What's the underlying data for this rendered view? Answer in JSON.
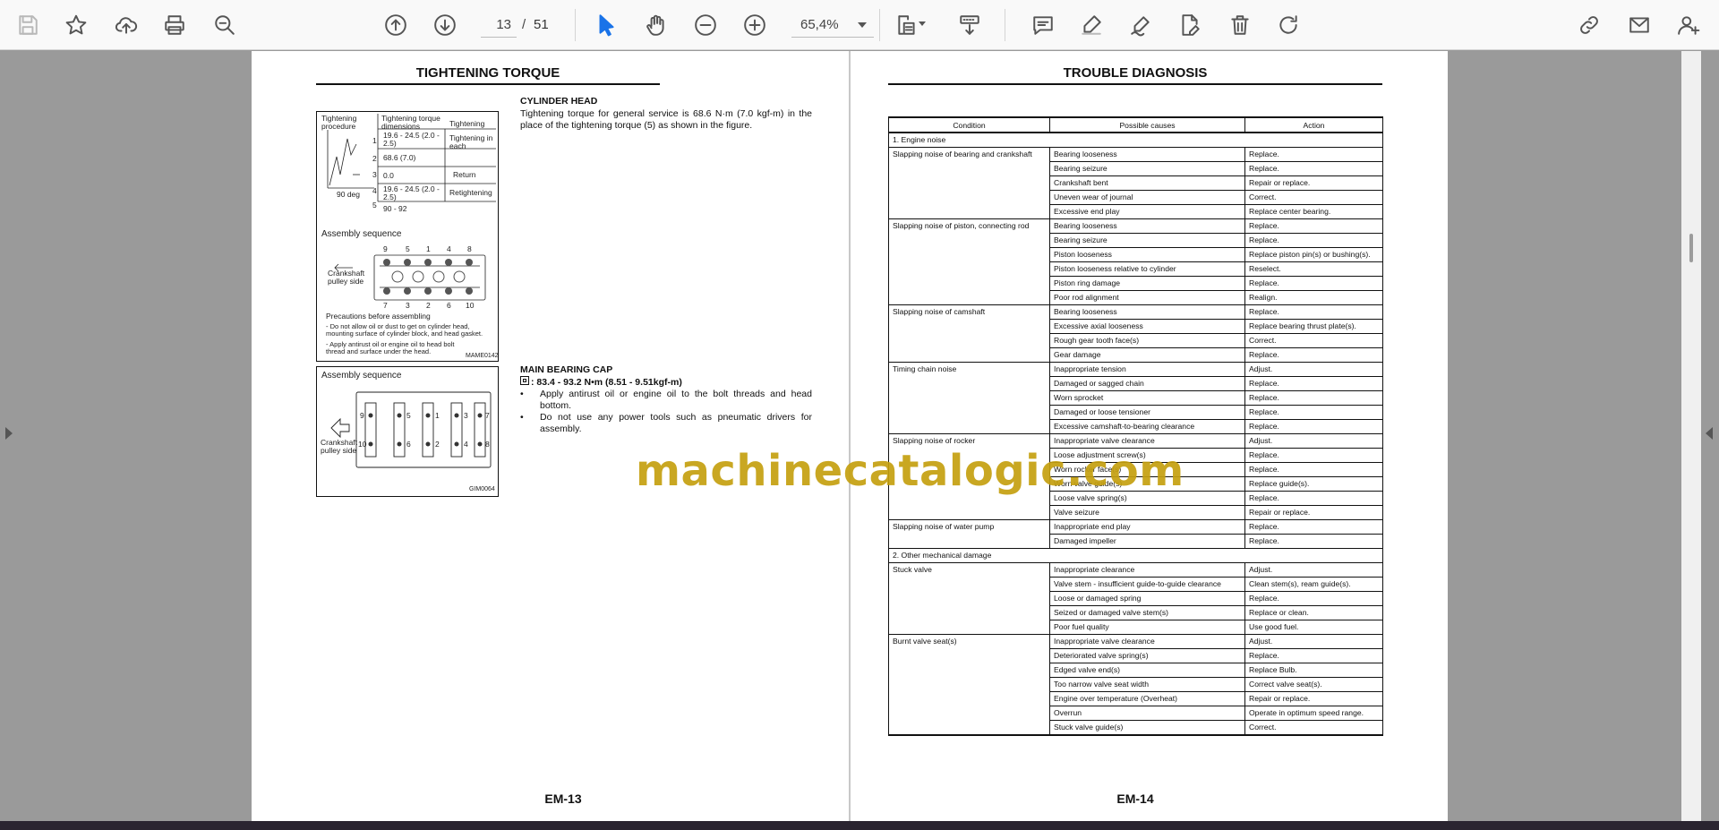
{
  "toolbar": {
    "page_current": "13",
    "page_separator": "/",
    "page_total": "51",
    "zoom": "65,4%",
    "accent_color": "#1a73e8"
  },
  "left_page": {
    "title": "TIGHTENING TORQUE",
    "cylinder_head": {
      "heading": "CYLINDER HEAD",
      "text": "Tightening torque for general service is 68.6 N·m (7.0 kgf-m) in the place of the tightening torque (5) as shown in the figure."
    },
    "main_bearing_cap": {
      "heading": "MAIN BEARING CAP",
      "torque": ": 83.4 - 93.2 N•m (8.51 - 9.51kgf-m)",
      "bullets": [
        "Apply antirust oil or engine oil to the bolt threads and head bottom.",
        "Do not use any power tools such as pneumatic drivers for assembly."
      ]
    },
    "figure1": {
      "label_procedure": "Tightening procedure",
      "label_dimensions": "Tightening torque dimensions",
      "label_direction": "Tightening",
      "label_tightening_in": "Tightening in each",
      "label_return": "Return",
      "label_retightening": "Retightening",
      "row1": "19.6 - 24.5 (2.0 - 2.5)",
      "row2": "68.6 (7.0)",
      "row3": "0.0",
      "row4": "19.6 - 24.5 (2.0 - 2.5)",
      "row5": "90 - 92",
      "steps": [
        "1",
        "2",
        "3",
        "4",
        "5"
      ],
      "axis_label": "Tightening torque",
      "angle_label": "90 deg",
      "assembly_title": "Assembly sequence",
      "crankshaft_label": "Crankshaft pulley side",
      "precautions_title": "Precautions before assembling",
      "precaution1": "- Do not allow oil or dust to get on cylinder head, mounting surface of cylinder block, and head gasket.",
      "precaution2": "- Apply antirust oil or engine oil to head bolt thread and surface under the head.",
      "code": "MAME0142",
      "top_numbers": [
        "9",
        "5",
        "1",
        "4",
        "8"
      ],
      "bottom_numbers": [
        "7",
        "3",
        "2",
        "6",
        "10"
      ]
    },
    "figure2": {
      "assembly_title": "Assembly sequence",
      "crankshaft_label": "Crankshaft pulley side",
      "code": "GIM0064",
      "top_numbers": [
        "9",
        "5",
        "1",
        "3",
        "7"
      ],
      "bottom_numbers": [
        "10",
        "6",
        "2",
        "4",
        "8"
      ]
    },
    "footer": "EM-13"
  },
  "right_page": {
    "title": "TROUBLE DIAGNOSIS",
    "table": {
      "headers": [
        "Condition",
        "Possible causes",
        "Action"
      ],
      "sections": [
        {
          "title": "1. Engine noise",
          "groups": [
            {
              "condition": "Slapping noise of bearing and crankshaft",
              "rows": [
                [
                  "Bearing looseness",
                  "Replace."
                ],
                [
                  "Bearing seizure",
                  "Replace."
                ],
                [
                  "Crankshaft bent",
                  "Repair or replace."
                ],
                [
                  "Uneven wear of journal",
                  "Correct."
                ],
                [
                  "Excessive end play",
                  "Replace center bearing."
                ]
              ]
            },
            {
              "condition": "Slapping noise of piston, connecting rod",
              "rows": [
                [
                  "Bearing looseness",
                  "Replace."
                ],
                [
                  "Bearing seizure",
                  "Replace."
                ],
                [
                  "Piston looseness",
                  "Replace piston pin(s) or bushing(s)."
                ],
                [
                  "Piston looseness relative to cylinder",
                  "Reselect."
                ],
                [
                  "Piston ring damage",
                  "Replace."
                ],
                [
                  "Poor rod alignment",
                  "Realign."
                ]
              ]
            },
            {
              "condition": "Slapping noise of camshaft",
              "rows": [
                [
                  "Bearing looseness",
                  "Replace."
                ],
                [
                  "Excessive axial looseness",
                  "Replace bearing thrust plate(s)."
                ],
                [
                  "Rough gear tooth face(s)",
                  "Correct."
                ],
                [
                  "Gear damage",
                  "Replace."
                ]
              ]
            },
            {
              "condition": "Timing chain noise",
              "rows": [
                [
                  "Inappropriate tension",
                  "Adjust."
                ],
                [
                  "Damaged or sagged chain",
                  "Replace."
                ],
                [
                  "Worn sprocket",
                  "Replace."
                ],
                [
                  "Damaged or loose tensioner",
                  "Replace."
                ],
                [
                  "Excessive camshaft-to-bearing clearance",
                  "Replace."
                ]
              ]
            },
            {
              "condition": "Slapping noise of rocker",
              "rows": [
                [
                  "Inappropriate valve clearance",
                  "Adjust."
                ],
                [
                  "Loose adjustment screw(s)",
                  "Replace."
                ],
                [
                  "Worn rocker face(s)",
                  "Replace."
                ],
                [
                  "Worn valve guide(s)",
                  "Replace guide(s)."
                ],
                [
                  "Loose valve spring(s)",
                  "Replace."
                ],
                [
                  "Valve seizure",
                  "Repair or replace."
                ]
              ]
            },
            {
              "condition": "Slapping noise of water pump",
              "rows": [
                [
                  "Inappropriate end play",
                  "Replace."
                ],
                [
                  "Damaged impeller",
                  "Replace."
                ]
              ]
            }
          ]
        },
        {
          "title": "2. Other mechanical damage",
          "groups": [
            {
              "condition": "Stuck valve",
              "rows": [
                [
                  "Inappropriate clearance",
                  "Adjust."
                ],
                [
                  "Valve stem - insufficient guide-to-guide clearance",
                  "Clean stem(s), ream guide(s)."
                ],
                [
                  "Loose or damaged spring",
                  "Replace."
                ],
                [
                  "Seized or damaged valve stem(s)",
                  "Replace or clean."
                ],
                [
                  "Poor fuel quality",
                  "Use good fuel."
                ]
              ]
            },
            {
              "condition": "Burnt valve seat(s)",
              "rows": [
                [
                  "Inappropriate valve clearance",
                  "Adjust."
                ],
                [
                  "Deteriorated valve spring(s)",
                  "Replace."
                ],
                [
                  "Edged valve end(s)",
                  "Replace Bulb."
                ],
                [
                  "Too narrow valve seat width",
                  "Correct valve seat(s)."
                ],
                [
                  "Engine over temperature (Overheat)",
                  "Repair or replace."
                ],
                [
                  "Overrun",
                  "Operate in optimum speed range."
                ],
                [
                  "Stuck valve guide(s)",
                  "Correct."
                ]
              ]
            }
          ]
        }
      ]
    },
    "footer": "EM-14"
  },
  "watermark": {
    "text": "machinecatalogic.com",
    "color": "#c5a010"
  }
}
